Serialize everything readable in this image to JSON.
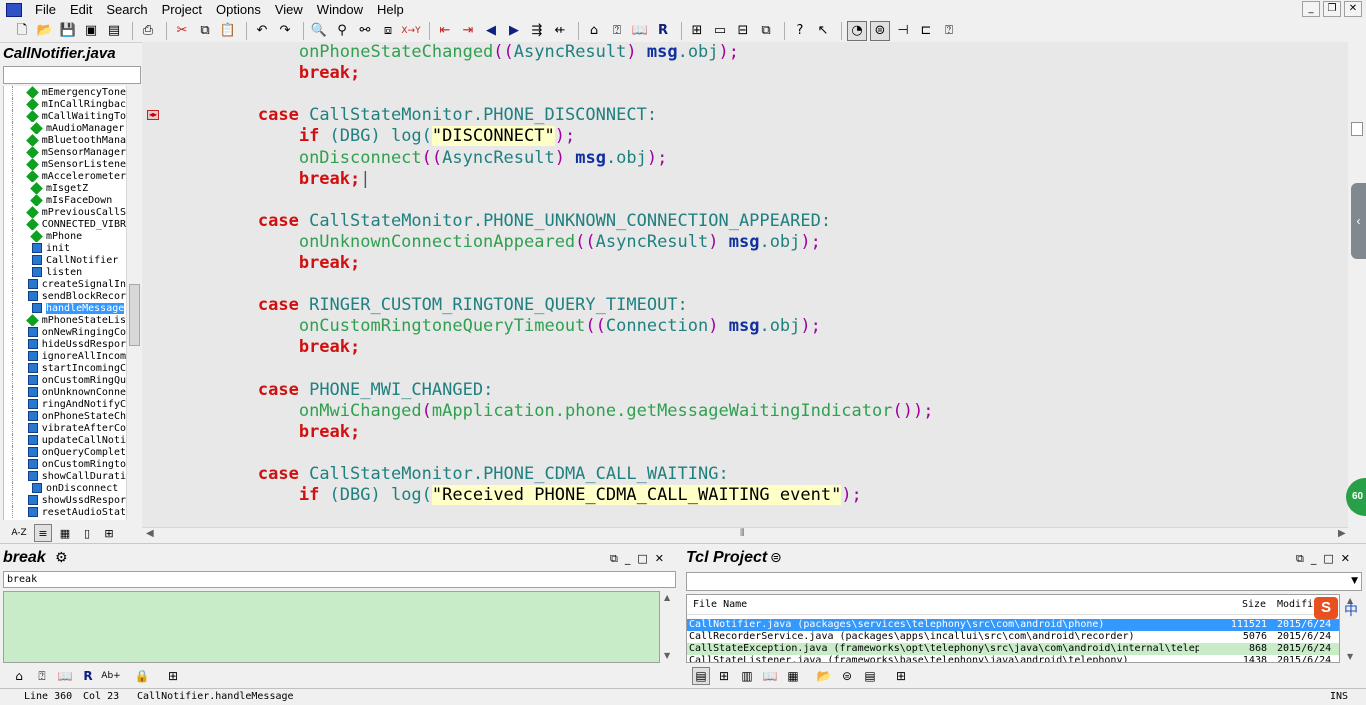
{
  "menu": {
    "items": [
      "File",
      "Edit",
      "Search",
      "Project",
      "Options",
      "View",
      "Window",
      "Help"
    ]
  },
  "window_buttons": [
    "_",
    "❐",
    "✕"
  ],
  "toolbar": {
    "icons": [
      "new-file-icon",
      "open-folder-icon",
      "save-icon",
      "save-all-icon",
      "close-file-icon",
      "print-icon",
      "cut-icon",
      "copy-icon",
      "paste-icon",
      "undo-icon",
      "redo-icon",
      "find-icon",
      "find-in-files-icon",
      "find-next-icon",
      "replace-icon",
      "replace-case-icon",
      "bookmark-prev-icon",
      "bookmark-next-icon",
      "back-icon",
      "forward-icon",
      "jump-icon",
      "outdent-icon",
      "project-window-icon",
      "symbol-window-icon",
      "browse-icon",
      "relation-icon",
      "layout-1-icon",
      "layout-2-icon",
      "layout-3-icon",
      "layout-4-icon",
      "help-icon",
      "pointer-help-icon",
      "toggle-1-icon",
      "toggle-2-icon",
      "split-icon",
      "tree-icon",
      "context-help-icon"
    ]
  },
  "symbol_panel": {
    "title": "CallNotifier.java",
    "filter": "",
    "items": [
      {
        "name": "mEmergencyTone",
        "kind": "field"
      },
      {
        "name": "mInCallRingbac",
        "kind": "field"
      },
      {
        "name": "mCallWaitingTo",
        "kind": "field"
      },
      {
        "name": "mAudioManager",
        "kind": "field"
      },
      {
        "name": "mBluetoothMana",
        "kind": "field"
      },
      {
        "name": "mSensorManager",
        "kind": "field"
      },
      {
        "name": "mSensorListene",
        "kind": "field"
      },
      {
        "name": "mAccelerometer",
        "kind": "field"
      },
      {
        "name": "mIsgetZ",
        "kind": "field"
      },
      {
        "name": "mIsFaceDown",
        "kind": "field"
      },
      {
        "name": "mPreviousCallS",
        "kind": "field"
      },
      {
        "name": "CONNECTED_VIBR",
        "kind": "field"
      },
      {
        "name": "mPhone",
        "kind": "field"
      },
      {
        "name": "init",
        "kind": "method"
      },
      {
        "name": "CallNotifier",
        "kind": "method"
      },
      {
        "name": "listen",
        "kind": "method"
      },
      {
        "name": "createSignalIn",
        "kind": "method"
      },
      {
        "name": "sendBlockRecor",
        "kind": "method"
      },
      {
        "name": "handleMessage",
        "kind": "method",
        "selected": true
      },
      {
        "name": "mPhoneStateLis",
        "kind": "field"
      },
      {
        "name": "onNewRingingCo",
        "kind": "method"
      },
      {
        "name": "hideUssdRespor",
        "kind": "method"
      },
      {
        "name": "ignoreAllIncom",
        "kind": "method"
      },
      {
        "name": "startIncomingC",
        "kind": "method"
      },
      {
        "name": "onCustomRingQu",
        "kind": "method"
      },
      {
        "name": "onUnknownConne",
        "kind": "method"
      },
      {
        "name": "ringAndNotifyC",
        "kind": "method"
      },
      {
        "name": "onPhoneStateCh",
        "kind": "method"
      },
      {
        "name": "vibrateAfterCo",
        "kind": "method"
      },
      {
        "name": "updateCallNoti",
        "kind": "method"
      },
      {
        "name": "onQueryComplet",
        "kind": "method"
      },
      {
        "name": "onCustomRingto",
        "kind": "method"
      },
      {
        "name": "showCallDurati",
        "kind": "method"
      },
      {
        "name": "onDisconnect",
        "kind": "method"
      },
      {
        "name": "showUssdRespor",
        "kind": "method"
      },
      {
        "name": "resetAudioStat",
        "kind": "method"
      }
    ],
    "tabs": [
      "A-Z",
      "≡",
      "▦",
      "▯",
      "⊞"
    ]
  },
  "editor": {
    "lines": [
      [
        {
          "t": "            ",
          "c": ""
        },
        {
          "t": "onPhoneStateChanged",
          "c": "fn"
        },
        {
          "t": "((",
          "c": "paren"
        },
        {
          "t": "AsyncResult",
          "c": "ty"
        },
        {
          "t": ") ",
          "c": "paren"
        },
        {
          "t": "msg",
          "c": "var"
        },
        {
          "t": ".obj",
          "c": "id"
        },
        {
          "t": ");",
          "c": "paren"
        }
      ],
      [
        {
          "t": "            ",
          "c": ""
        },
        {
          "t": "break",
          "c": "kw"
        },
        {
          "t": ";",
          "c": "kw"
        }
      ],
      [
        {
          "t": "",
          "c": ""
        }
      ],
      [
        {
          "t": "        ",
          "c": ""
        },
        {
          "t": "case",
          "c": "kw"
        },
        {
          "t": " CallStateMonitor.PHONE_DISCONNECT:",
          "c": "id"
        }
      ],
      [
        {
          "t": "            ",
          "c": ""
        },
        {
          "t": "if",
          "c": "kw"
        },
        {
          "t": " (DBG) log(",
          "c": "id"
        },
        {
          "t": "\"DISCONNECT\"",
          "c": "str"
        },
        {
          "t": ");",
          "c": "paren"
        }
      ],
      [
        {
          "t": "            ",
          "c": ""
        },
        {
          "t": "onDisconnect",
          "c": "fn"
        },
        {
          "t": "((",
          "c": "paren"
        },
        {
          "t": "AsyncResult",
          "c": "ty"
        },
        {
          "t": ") ",
          "c": "paren"
        },
        {
          "t": "msg",
          "c": "var"
        },
        {
          "t": ".obj",
          "c": "id"
        },
        {
          "t": ");",
          "c": "paren"
        }
      ],
      [
        {
          "t": "            ",
          "c": ""
        },
        {
          "t": "break",
          "c": "kw"
        },
        {
          "t": ";",
          "c": "kw"
        },
        {
          "t": "|",
          "c": ""
        }
      ],
      [
        {
          "t": "",
          "c": ""
        }
      ],
      [
        {
          "t": "        ",
          "c": ""
        },
        {
          "t": "case",
          "c": "kw"
        },
        {
          "t": " CallStateMonitor.PHONE_UNKNOWN_CONNECTION_APPEARED:",
          "c": "id"
        }
      ],
      [
        {
          "t": "            ",
          "c": ""
        },
        {
          "t": "onUnknownConnectionAppeared",
          "c": "fn"
        },
        {
          "t": "((",
          "c": "paren"
        },
        {
          "t": "AsyncResult",
          "c": "ty"
        },
        {
          "t": ") ",
          "c": "paren"
        },
        {
          "t": "msg",
          "c": "var"
        },
        {
          "t": ".obj",
          "c": "id"
        },
        {
          "t": ");",
          "c": "paren"
        }
      ],
      [
        {
          "t": "            ",
          "c": ""
        },
        {
          "t": "break",
          "c": "kw"
        },
        {
          "t": ";",
          "c": "kw"
        }
      ],
      [
        {
          "t": "",
          "c": ""
        }
      ],
      [
        {
          "t": "        ",
          "c": ""
        },
        {
          "t": "case",
          "c": "kw"
        },
        {
          "t": " RINGER_CUSTOM_RINGTONE_QUERY_TIMEOUT:",
          "c": "id"
        }
      ],
      [
        {
          "t": "            ",
          "c": ""
        },
        {
          "t": "onCustomRingtoneQueryTimeout",
          "c": "fn"
        },
        {
          "t": "((",
          "c": "paren"
        },
        {
          "t": "Connection",
          "c": "ty"
        },
        {
          "t": ") ",
          "c": "paren"
        },
        {
          "t": "msg",
          "c": "var"
        },
        {
          "t": ".obj",
          "c": "id"
        },
        {
          "t": ");",
          "c": "paren"
        }
      ],
      [
        {
          "t": "            ",
          "c": ""
        },
        {
          "t": "break",
          "c": "kw"
        },
        {
          "t": ";",
          "c": "kw"
        }
      ],
      [
        {
          "t": "",
          "c": ""
        }
      ],
      [
        {
          "t": "        ",
          "c": ""
        },
        {
          "t": "case",
          "c": "kw"
        },
        {
          "t": " PHONE_MWI_CHANGED:",
          "c": "id"
        }
      ],
      [
        {
          "t": "            ",
          "c": ""
        },
        {
          "t": "onMwiChanged",
          "c": "fn"
        },
        {
          "t": "(",
          "c": "paren"
        },
        {
          "t": "mApplication.phone.getMessageWaitingIndicator",
          "c": "fn"
        },
        {
          "t": "());",
          "c": "paren"
        }
      ],
      [
        {
          "t": "            ",
          "c": ""
        },
        {
          "t": "break",
          "c": "kw"
        },
        {
          "t": ";",
          "c": "kw"
        }
      ],
      [
        {
          "t": "",
          "c": ""
        }
      ],
      [
        {
          "t": "        ",
          "c": ""
        },
        {
          "t": "case",
          "c": "kw"
        },
        {
          "t": " CallStateMonitor.PHONE_CDMA_CALL_WAITING:",
          "c": "id"
        }
      ],
      [
        {
          "t": "            ",
          "c": ""
        },
        {
          "t": "if",
          "c": "kw"
        },
        {
          "t": " (DBG) log(",
          "c": "id"
        },
        {
          "t": "\"Received PHONE_CDMA_CALL_WAITING event\"",
          "c": "str"
        },
        {
          "t": ");",
          "c": "paren"
        }
      ]
    ]
  },
  "side_badge": "60",
  "bottom_left": {
    "title": "break",
    "search_value": "break",
    "controls": [
      "⧉",
      "_",
      "□",
      "✕"
    ]
  },
  "bottom_right": {
    "title": "Tcl Project",
    "controls": [
      "⧉",
      "_",
      "□",
      "✕"
    ],
    "columns": {
      "name": "File Name",
      "size": "Size",
      "modified": "Modifi"
    },
    "files": [
      {
        "name": "CallNotifier.java (packages\\services\\telephony\\src\\com\\android\\phone)",
        "size": "111521",
        "modified": "2015/6/24"
      },
      {
        "name": "CallRecorderService.java (packages\\apps\\incallui\\src\\com\\android\\recorder)",
        "size": "5076",
        "modified": "2015/6/24"
      },
      {
        "name": "CallStateException.java (frameworks\\opt\\telephony\\src\\java\\com\\android\\internal\\telep",
        "size": "868",
        "modified": "2015/6/24"
      },
      {
        "name": "CallStateListener.java (frameworks\\base\\telephony\\java\\android\\telephony)",
        "size": "1438",
        "modified": "2015/6/24"
      }
    ]
  },
  "ime": {
    "logo": "S",
    "lang": "中"
  },
  "status": {
    "line": "Line 360",
    "col": "Col 23",
    "symbol": "CallNotifier.handleMessage",
    "mode": "INS"
  }
}
